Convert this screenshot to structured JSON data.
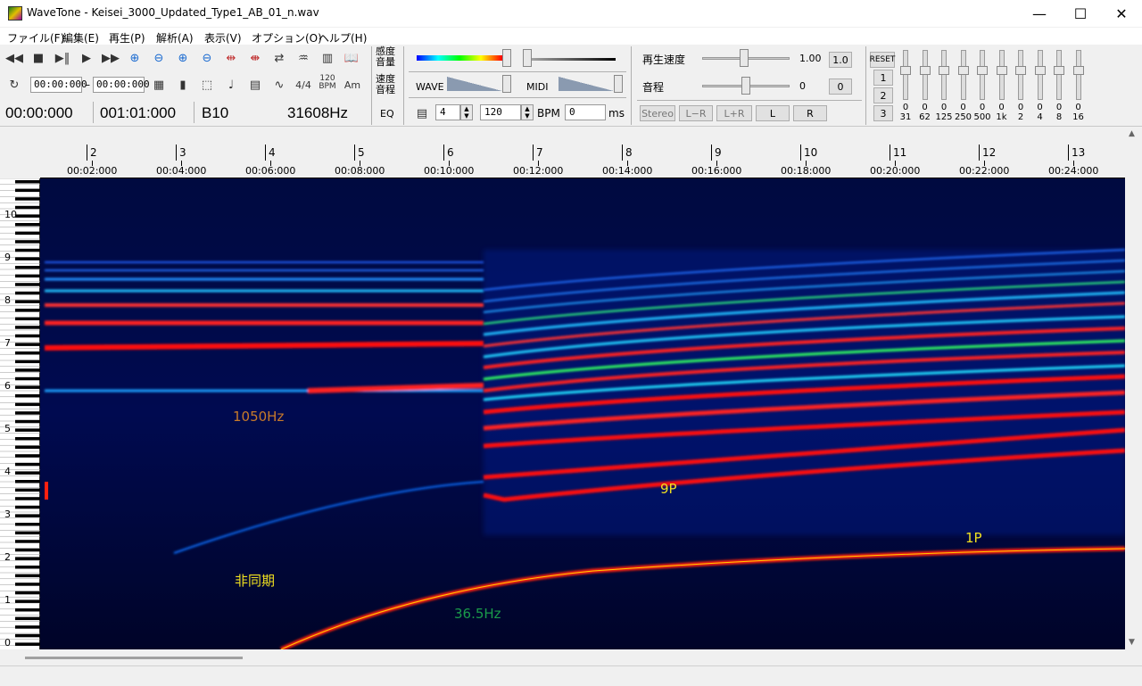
{
  "window": {
    "title": "WaveTone - Keisei_3000_Updated_Type1_AB_01_n.wav",
    "min": "—",
    "max": "☐",
    "close": "✕"
  },
  "menu": [
    "ファイル(F)",
    "編集(E)",
    "再生(P)",
    "解析(A)",
    "表示(V)",
    "オプション(O)",
    "ヘルプ(H)"
  ],
  "toolbar": {
    "range_start": "00:00:000",
    "range_dash": "–",
    "range_end": "00:00:000",
    "time_sig": "4/4",
    "bpm_icon_top": "120",
    "bpm_icon_bottom": "BPM",
    "chord_icon": "Am",
    "position_time": "00:00:000",
    "position_measure": "001:01:000",
    "note": "B10",
    "frequency": "31608Hz",
    "sensitivity_top": "感度",
    "sensitivity_bottom": "音量",
    "speed_top": "速度",
    "speed_bottom": "音程",
    "eq_label": "EQ",
    "wave_label": "WAVE",
    "midi_label": "MIDI",
    "beats_value": "4",
    "bpm_value": "120",
    "bpm_label": "BPM",
    "ms_value": "0",
    "ms_label": "ms",
    "speed_label": "再生速度",
    "speed_value": "1.00",
    "speed_reset": "1.0",
    "pitch_label": "音程",
    "pitch_value": "0",
    "pitch_reset": "0",
    "stereo": "Stereo",
    "lr_minus": "L−R",
    "lr_plus": "L+R",
    "left": "L",
    "right": "R",
    "reset": "RESET",
    "preset1": "1",
    "preset2": "2",
    "preset3": "3",
    "eq_bands": [
      {
        "gain": "0",
        "freq": "31"
      },
      {
        "gain": "0",
        "freq": "62"
      },
      {
        "gain": "0",
        "freq": "125"
      },
      {
        "gain": "0",
        "freq": "250"
      },
      {
        "gain": "0",
        "freq": "500"
      },
      {
        "gain": "0",
        "freq": "1k"
      },
      {
        "gain": "0",
        "freq": "2"
      },
      {
        "gain": "0",
        "freq": "4"
      },
      {
        "gain": "0",
        "freq": "8"
      },
      {
        "gain": "0",
        "freq": "16"
      }
    ]
  },
  "ruler": {
    "bars": [
      "2",
      "3",
      "4",
      "5",
      "6",
      "7",
      "8",
      "9",
      "10",
      "11",
      "12",
      "13"
    ],
    "times": [
      "00:02:000",
      "00:04:000",
      "00:06:000",
      "00:08:000",
      "00:10:000",
      "00:12:000",
      "00:14:000",
      "00:16:000",
      "00:18:000",
      "00:20:000",
      "00:22:000",
      "00:24:000"
    ]
  },
  "piano_octaves": [
    "10",
    "9",
    "8",
    "7",
    "6",
    "5",
    "4",
    "3",
    "2",
    "1",
    "0"
  ],
  "annotations": {
    "freq_1050": "1050Hz",
    "nine_p": "9P",
    "one_p": "1P",
    "async": "非同期",
    "freq_36": "36.5Hz"
  },
  "colors": {
    "anno_orange": "#c87a2a",
    "anno_yellow": "#f0e020",
    "anno_green": "#1a9a4a",
    "spectro_bg": "#000428"
  }
}
